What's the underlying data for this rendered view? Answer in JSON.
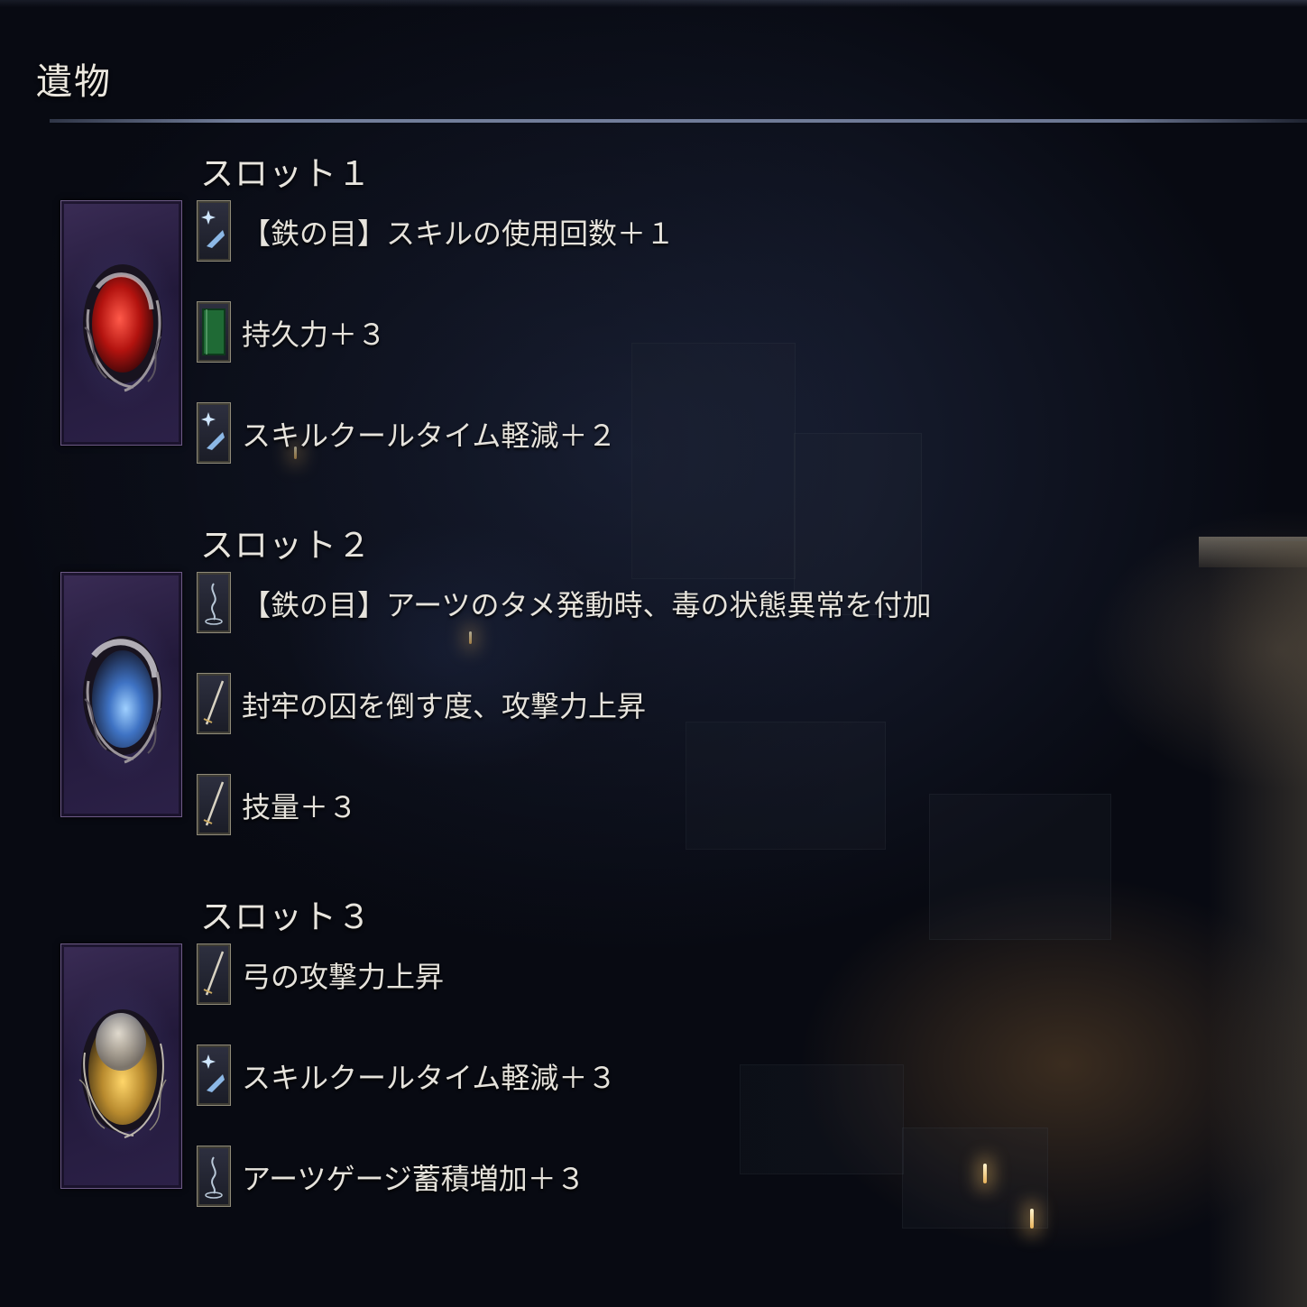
{
  "screen": {
    "title": "遺物"
  },
  "slots": [
    {
      "label": "スロット１",
      "gem_color": "#c8261e",
      "effects": [
        {
          "icon": "skill-star-icon",
          "text": "【鉄の目】スキルの使用回数＋１"
        },
        {
          "icon": "green-book-icon",
          "text": "持久力＋３"
        },
        {
          "icon": "skill-star-icon",
          "text": "スキルクールタイム軽減＋２"
        }
      ]
    },
    {
      "label": "スロット２",
      "gem_color": "#4f86d6",
      "effects": [
        {
          "icon": "arts-swirl-icon",
          "text": "【鉄の目】アーツのタメ発動時、毒の状態異常を付加"
        },
        {
          "icon": "sword-icon",
          "text": "封牢の囚を倒す度、攻撃力上昇"
        },
        {
          "icon": "sword-icon",
          "text": "技量＋３"
        }
      ]
    },
    {
      "label": "スロット３",
      "gem_color": "#d8a83a",
      "effects": [
        {
          "icon": "sword-icon",
          "text": "弓の攻撃力上昇"
        },
        {
          "icon": "skill-star-icon",
          "text": "スキルクールタイム軽減＋３"
        },
        {
          "icon": "arts-swirl-icon",
          "text": "アーツゲージ蓄積増加＋３"
        }
      ]
    }
  ]
}
